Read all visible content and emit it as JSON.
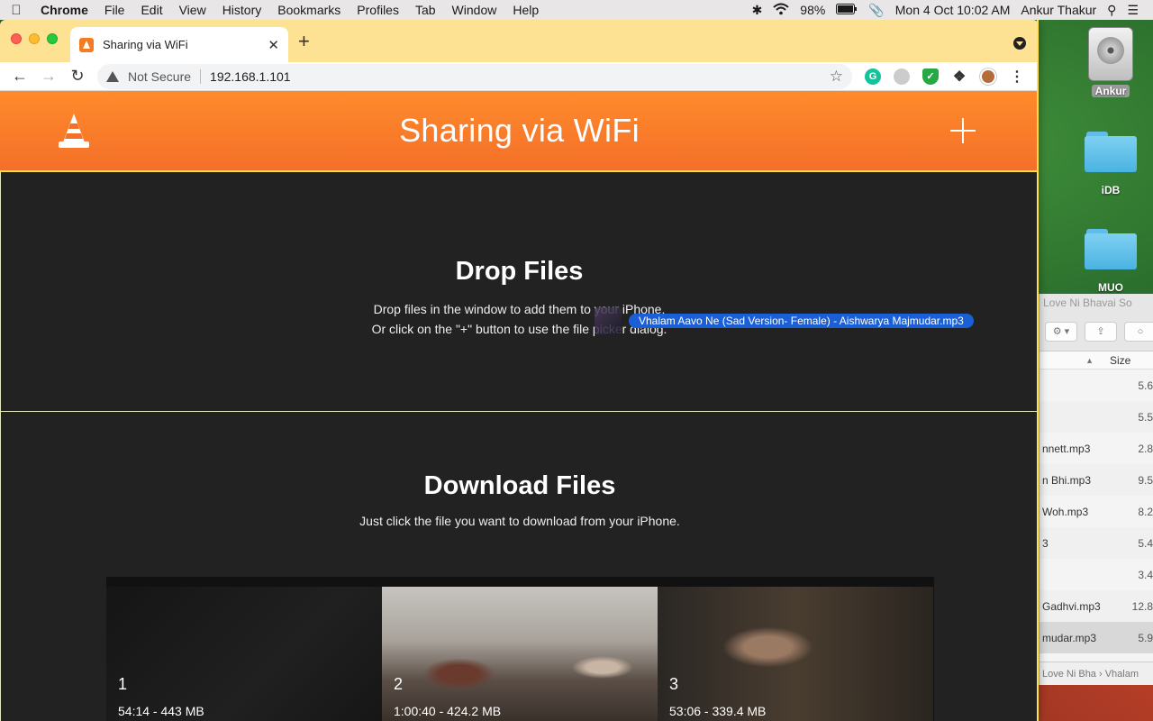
{
  "menubar": {
    "apple": "",
    "items": [
      "Chrome",
      "File",
      "Edit",
      "View",
      "History",
      "Bookmarks",
      "Profiles",
      "Tab",
      "Window",
      "Help"
    ],
    "battery": "98%",
    "datetime": "Mon 4 Oct  10:02 AM",
    "user": "Ankur Thakur"
  },
  "desktop": {
    "disk_label": "Ankur",
    "folders": [
      "iDB",
      "MUO"
    ]
  },
  "finder": {
    "title": "Love Ni Bhavai So",
    "column_size": "Size",
    "rows": [
      {
        "name": "",
        "size": "5.6"
      },
      {
        "name": "",
        "size": "5.5"
      },
      {
        "name": "nnett.mp3",
        "size": "2.8"
      },
      {
        "name": "n Bhi.mp3",
        "size": "9.5"
      },
      {
        "name": " Woh.mp3",
        "size": "8.2"
      },
      {
        "name": "3",
        "size": "5.4"
      },
      {
        "name": "",
        "size": "3.4"
      },
      {
        "name": "Gadhvi.mp3",
        "size": "12.8"
      },
      {
        "name": "mudar.mp3",
        "size": "5.9"
      }
    ],
    "path": "Love Ni Bha ›  Vhalam"
  },
  "browser": {
    "tab_title": "Sharing via WiFi",
    "security_label": "Not Secure",
    "url": "192.168.1.101"
  },
  "page": {
    "banner_title": "Sharing via WiFi",
    "drop_title": "Drop Files",
    "drop_line1": "Drop files in the window to add them to your iPhone.",
    "drop_line2": "Or click on the \"+\" button to use the file picker dialog.",
    "dragged_file": "Vhalam Aavo Ne (Sad Version- Female) - Aishwarya Majmudar.mp3",
    "download_title": "Download Files",
    "download_subtitle": "Just click the file you want to download from your iPhone.",
    "files": [
      {
        "index": "1",
        "meta": "54:14 - 443 MB"
      },
      {
        "index": "2",
        "meta": "1:00:40 - 424.2 MB"
      },
      {
        "index": "3",
        "meta": "53:06 - 339.4 MB"
      }
    ]
  }
}
